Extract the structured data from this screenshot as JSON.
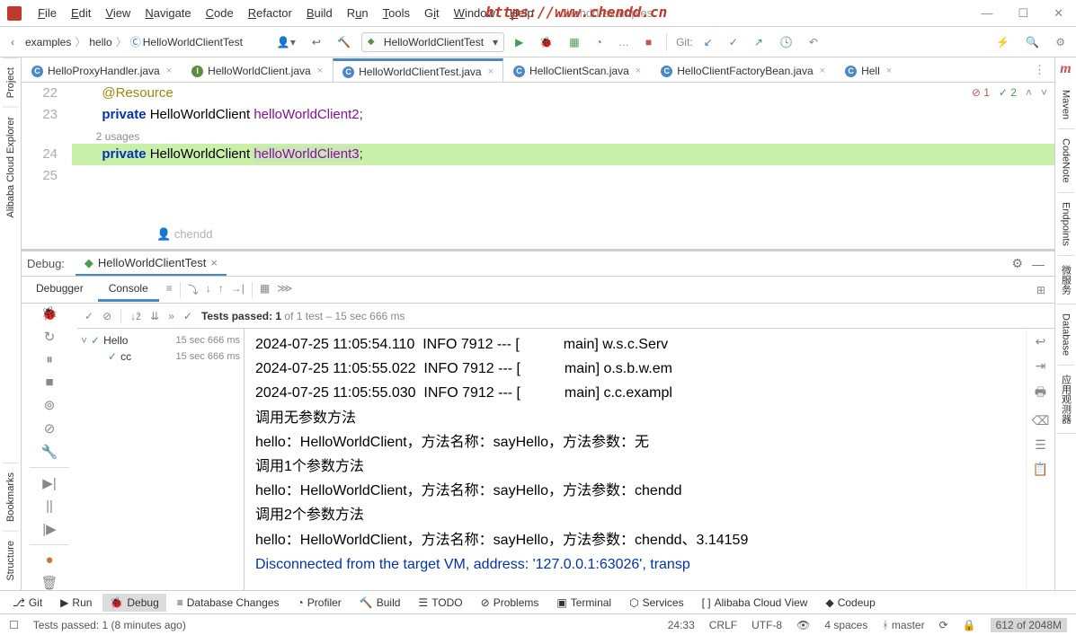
{
  "project_name": "chendd-examples",
  "menu": [
    "File",
    "Edit",
    "View",
    "Navigate",
    "Code",
    "Refactor",
    "Build",
    "Run",
    "Tools",
    "Git",
    "Window",
    "Help"
  ],
  "breadcrumb": {
    "p1": "examples",
    "p2": "hello",
    "p3": "HelloWorldClientTest"
  },
  "run_config": "HelloWorldClientTest",
  "git_label": "Git:",
  "editor_tabs": [
    {
      "label": "HelloProxyHandler.java",
      "active": false,
      "icon": "C"
    },
    {
      "label": "HelloWorldClient.java",
      "active": false,
      "icon": "I"
    },
    {
      "label": "HelloWorldClientTest.java",
      "active": true,
      "icon": "C"
    },
    {
      "label": "HelloClientScan.java",
      "active": false,
      "icon": "C"
    },
    {
      "label": "HelloClientFactoryBean.java",
      "active": false,
      "icon": "C"
    },
    {
      "label": "Hell",
      "active": false,
      "icon": "C"
    }
  ],
  "annotations": {
    "errors": "1",
    "warnings": "2"
  },
  "code_lines": [
    {
      "num": "22",
      "html": "        <span class='ann'>@Resource</span>"
    },
    {
      "num": "23",
      "html": "        <span class='kw'>private</span> <span class='ty'>HelloWorldClient</span> <span class='fld'>helloWorldClient2</span>;"
    },
    {
      "num": "",
      "html": "        <span class='cmt'>2 usages</span>",
      "inlay": true
    },
    {
      "num": "24",
      "html": "        <span class='kw'>private</span> <span class='ty'>HelloWorldClient</span> <span class='fld fldhl'>helloWorldClient3</span>;",
      "hl": true
    },
    {
      "num": "25",
      "html": ""
    }
  ],
  "author_hint": "chendd",
  "debug": {
    "label": "Debug:",
    "tab_label": "HelloWorldClientTest",
    "sub_tabs": [
      "Debugger",
      "Console"
    ],
    "active_sub": 1,
    "test_summary_pre": "Tests passed: 1",
    "test_summary_post": " of 1 test – 15 sec 666 ms",
    "tree": [
      {
        "name": "Hello",
        "time": "15 sec 666 ms",
        "lvl": 0,
        "exp": true
      },
      {
        "name": "cc",
        "time": "15 sec 666 ms",
        "lvl": 1
      }
    ],
    "watermark": "https://www.chendd.cn"
  },
  "console_lines": [
    "2024-07-25 11:05:54.110  INFO 7912 --- [           main] w.s.c.Serv",
    "2024-07-25 11:05:55.022  INFO 7912 --- [           main] o.s.b.w.em",
    "2024-07-25 11:05:55.030  INFO 7912 --- [           main] c.c.exampl",
    "调用无参数方法",
    "hello：HelloWorldClient，方法名称：sayHello，方法参数：无",
    "调用1个参数方法",
    "hello：HelloWorldClient，方法名称：sayHello，方法参数：chendd",
    "调用2个参数方法",
    "hello：HelloWorldClient，方法名称：sayHello，方法参数：chendd、3.14159"
  ],
  "console_disc": "Disconnected from the target VM, address: '127.0.0.1:63026', transp",
  "left_tool_tabs": [
    "Project",
    "Alibaba Cloud Explorer",
    "Bookmarks",
    "Structure"
  ],
  "right_tool_tabs": [
    "Maven",
    "CodeNote",
    "Endpoints",
    "微服务",
    "Database",
    "应用观测器"
  ],
  "bottom_tabs": [
    {
      "label": "Git",
      "icon": "⎇"
    },
    {
      "label": "Run",
      "icon": "▶"
    },
    {
      "label": "Debug",
      "icon": "🐞",
      "active": true
    },
    {
      "label": "Database Changes",
      "icon": "≡"
    },
    {
      "label": "Profiler",
      "icon": "◔"
    },
    {
      "label": "Build",
      "icon": "🔨"
    },
    {
      "label": "TODO",
      "icon": "☰"
    },
    {
      "label": "Problems",
      "icon": "⊘"
    },
    {
      "label": "Terminal",
      "icon": "▣"
    },
    {
      "label": "Services",
      "icon": "⬡"
    },
    {
      "label": "Alibaba Cloud View",
      "icon": "[ ]"
    },
    {
      "label": "Codeup",
      "icon": "◆"
    }
  ],
  "status": {
    "msg": "Tests passed: 1 (8 minutes ago)",
    "pos": "24:33",
    "sep": "CRLF",
    "enc": "UTF-8",
    "indent": "4 spaces",
    "branch": "master",
    "mem": "612 of 2048M"
  }
}
